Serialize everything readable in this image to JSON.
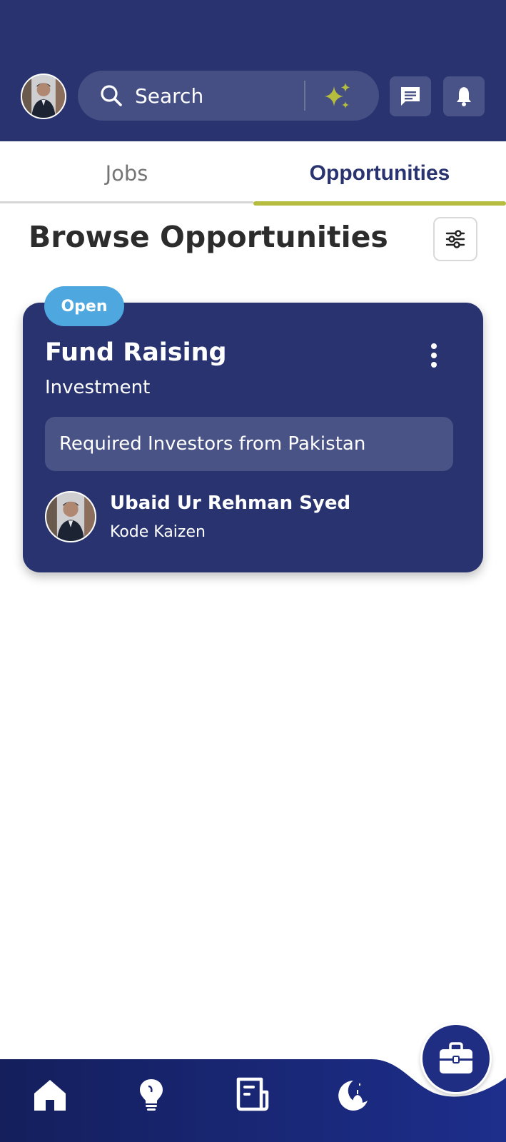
{
  "header": {
    "avatar_icon": "profile-photo",
    "search": {
      "placeholder": "Search",
      "icon": "search-icon",
      "ai_icon": "sparkles-icon"
    },
    "actions": [
      {
        "name": "messages",
        "icon": "chat-icon"
      },
      {
        "name": "notifications",
        "icon": "bell-icon"
      }
    ]
  },
  "tabs": [
    {
      "label": "Jobs",
      "active": false
    },
    {
      "label": "Opportunities",
      "active": true
    }
  ],
  "page": {
    "title": "Browse Opportunities",
    "filter_icon": "sliders-icon"
  },
  "opportunities": [
    {
      "status": "Open",
      "title": "Fund Raising",
      "category": "Investment",
      "description": "Required Investors from Pakistan",
      "poster": {
        "name": "Ubaid Ur Rehman Syed",
        "company": "Kode Kaizen"
      }
    }
  ],
  "bottom_nav": {
    "items": [
      {
        "name": "home",
        "icon": "home-icon"
      },
      {
        "name": "ideas",
        "icon": "lightbulb-icon"
      },
      {
        "name": "news",
        "icon": "newspaper-icon"
      },
      {
        "name": "islamic",
        "icon": "crescent-mosque-icon"
      }
    ],
    "fab_icon": "briefcase-icon"
  },
  "colors": {
    "primary": "#283370",
    "accent": "#b6bc3e",
    "badge": "#4fa7e0",
    "search_bg": "#454f83"
  }
}
